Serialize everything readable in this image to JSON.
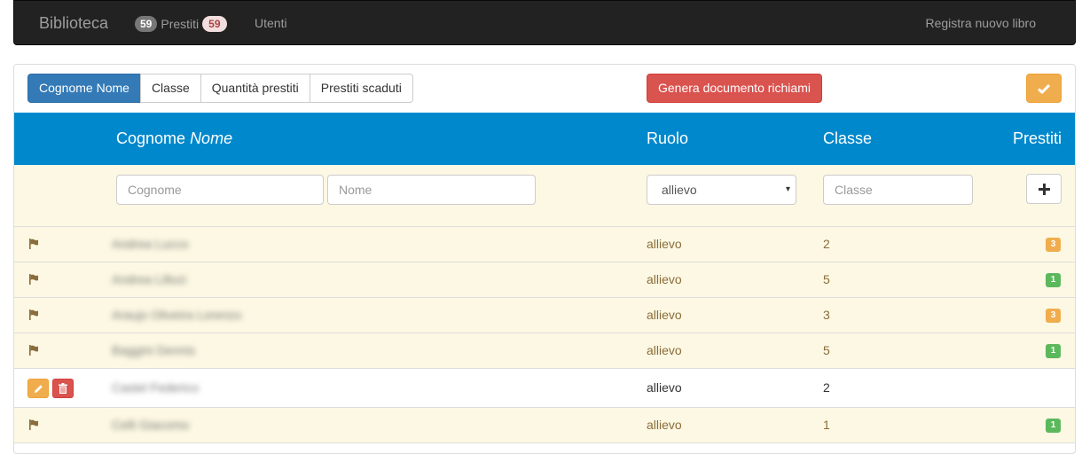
{
  "navbar": {
    "brand": "Biblioteca",
    "prestiti_count": "59",
    "prestiti_label": "Prestiti",
    "prestiti_overdue": "59",
    "utenti": "Utenti",
    "registra": "Registra nuovo libro"
  },
  "toolbar": {
    "sort_buttons": [
      "Cognome Nome",
      "Classe",
      "Quantità prestiti",
      "Prestiti scaduti"
    ],
    "active_sort": "Cognome Nome",
    "genera_label": "Genera documento richiami",
    "confirm_icon": "check-icon"
  },
  "table": {
    "headers": {
      "cognome": "Cognome",
      "nome": "Nome",
      "ruolo": "Ruolo",
      "classe": "Classe",
      "prestiti": "Prestiti"
    },
    "filters": {
      "cognome_placeholder": "Cognome",
      "nome_placeholder": "Nome",
      "ruolo_selected": "allievo",
      "classe_placeholder": "Classe",
      "add_icon": "plus-icon"
    },
    "rows": [
      {
        "name": "Andrea Lucco",
        "ruolo": "allievo",
        "classe": "2",
        "prestiti": "3",
        "state": "warn"
      },
      {
        "name": "Andrea Lillozi",
        "ruolo": "allievo",
        "classe": "5",
        "prestiti": "1",
        "state": "warn"
      },
      {
        "name": "Araujo Oliveira Lorenzo",
        "ruolo": "allievo",
        "classe": "3",
        "prestiti": "3",
        "state": "warn"
      },
      {
        "name": "Baggini Dennis",
        "ruolo": "allievo",
        "classe": "5",
        "prestiti": "1",
        "state": "warn"
      },
      {
        "name": "Castel Federico",
        "ruolo": "allievo",
        "classe": "2",
        "prestiti": "",
        "state": "plain"
      },
      {
        "name": "Celli Giacomo",
        "ruolo": "allievo",
        "classe": "1",
        "prestiti": "1",
        "state": "warn"
      }
    ]
  },
  "colors": {
    "navbar_bg": "#222222",
    "header_bg": "#0088cc",
    "warning_row_bg": "#fcf8e3",
    "primary": "#337ab7",
    "danger": "#d9534f",
    "warning": "#f0ad4e",
    "success": "#5cb85c"
  }
}
